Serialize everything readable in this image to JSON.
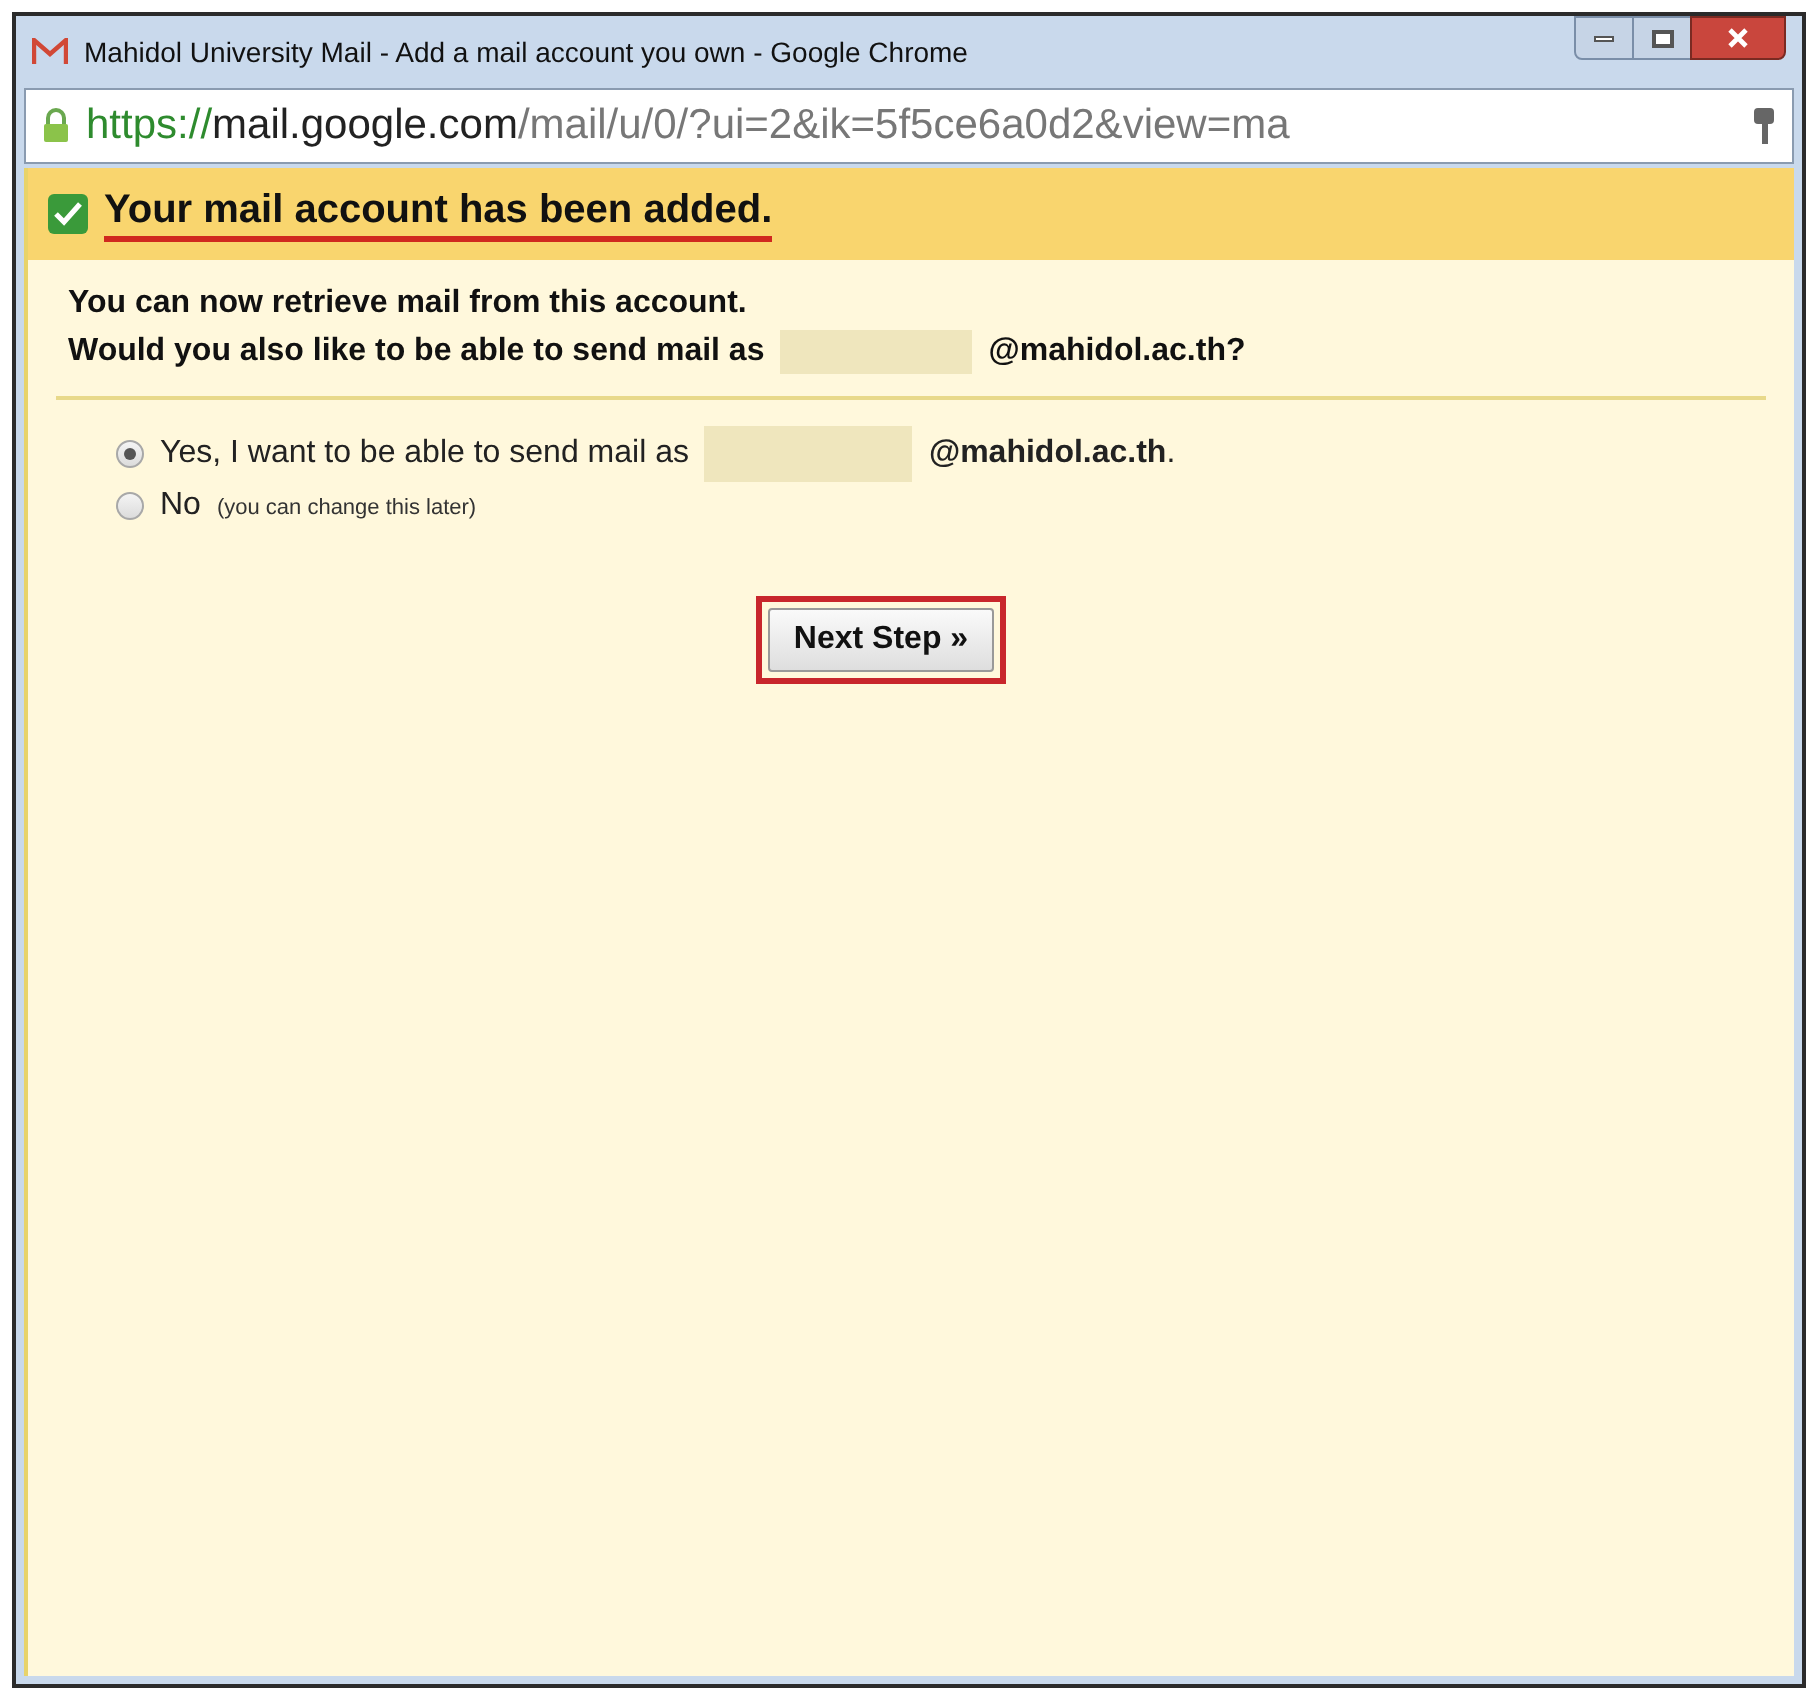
{
  "window": {
    "title": "Mahidol University Mail - Add a mail account you own - Google Chrome"
  },
  "address_bar": {
    "scheme": "https://",
    "domain": "mail.google.com",
    "path": "/mail/u/0/?ui=2&ik=5f5ce6a0d2&view=ma"
  },
  "banner": {
    "checked": true,
    "title": "Your mail account has been added."
  },
  "message": {
    "line_1": "You can now retrieve mail from this account.",
    "line_2_before": "Would you also like to be able to send mail as",
    "line_2_after": "@mahidol.ac.th?"
  },
  "options": [
    {
      "label": "Yes, I want to be able to send mail as",
      "suffix": "@mahidol.ac.th",
      "end": ".",
      "selected": true
    },
    {
      "label": "No",
      "note": "(you can change this later)",
      "selected": false
    }
  ],
  "button": {
    "label": "Next Step »"
  }
}
